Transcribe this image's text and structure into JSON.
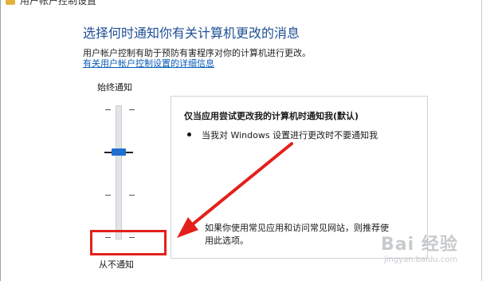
{
  "window": {
    "title": "用户帐户控制设置"
  },
  "main": {
    "heading": "选择何时通知你有关计算机更改的消息",
    "description": "用户帐户控制有助于预防有害程序对你的计算机进行更改。",
    "link": "有关用户帐户控制设置的详细信息"
  },
  "slider": {
    "top_label": "始终通知",
    "bottom_label": "从不通知",
    "levels": 4,
    "current_level": 3
  },
  "info": {
    "title": "仅当应用尝试更改我的计算机时通知我(默认)",
    "bullet": "当我对 Windows 设置进行更改时不要通知我",
    "recommendation": "如果你使用常见应用和访问常见网站，则推荐使用此选项。"
  },
  "watermark": {
    "logo": "Bai 经验",
    "url": "jingyan.baidu.com"
  },
  "annotation": {
    "highlight_color": "#e3201b"
  }
}
